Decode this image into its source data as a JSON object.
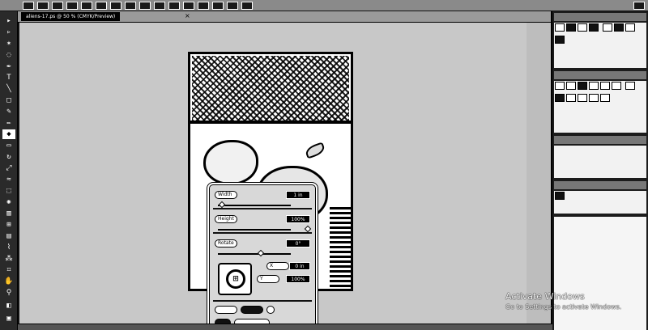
{
  "options_bar": {
    "buttons": [
      "",
      "",
      "",
      "",
      "",
      "",
      "",
      "",
      "",
      "",
      "",
      "",
      "",
      "",
      "",
      "",
      ""
    ],
    "zoom": "",
    "right_label": ""
  },
  "document": {
    "tab_title": "aliens-17.ps @ 50 % (CMYK/Preview)",
    "close_glyph": "×"
  },
  "dialog": {
    "row1_label": "Width",
    "row1_value": "1 in",
    "row2_label": "Height",
    "row2_value": "100%",
    "row3_label": "Rotate",
    "row3_value": "0°",
    "row4_label": "X",
    "row4_value": "0 in",
    "row5_label": "Y",
    "row5_value": "100%",
    "anchor_glyph": "⊞",
    "bottom_btn1": "",
    "bottom_btn2": "",
    "bottom_btn3": "",
    "bottom_btn4": ""
  },
  "right_panel": {
    "panel1_title": "",
    "panel2_title": "",
    "panel3_title": "",
    "panel4_title": ""
  },
  "watermark": {
    "line1": "Activate Windows",
    "line2": "Go to Settings to activate Windows."
  },
  "colors": {
    "accent": "#000000",
    "panel_bg": "#1c1c1c",
    "canvas_bg": "#c8c8c8"
  }
}
